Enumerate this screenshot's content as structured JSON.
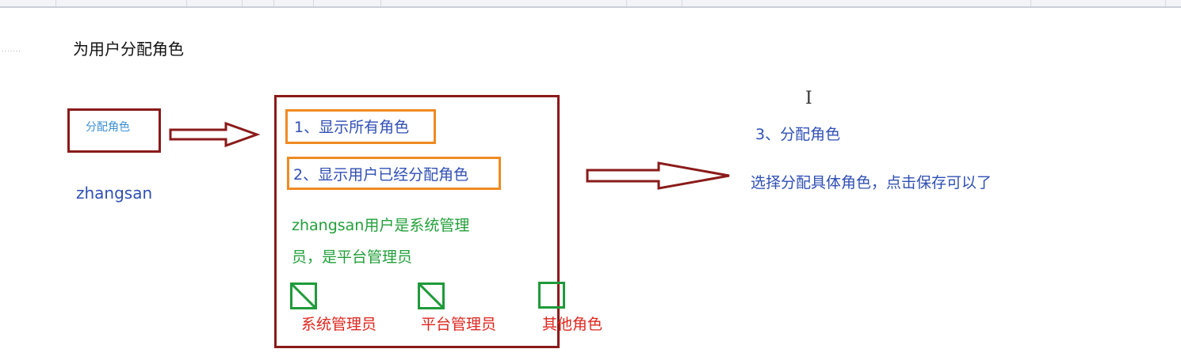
{
  "diagram": {
    "title": "为用户分配角色",
    "assign_button_label": "分配角色",
    "username": "zhangsan",
    "step1": "1、显示所有角色",
    "step2": "2、显示用户已经分配角色",
    "user_roles_line1": "zhangsan用户是系统管理",
    "user_roles_line2": "员，是平台管理员",
    "roles": [
      {
        "label": "系统管理员",
        "checked": true
      },
      {
        "label": "平台管理员",
        "checked": true
      },
      {
        "label": "其他角色",
        "checked": false
      }
    ],
    "step3": "3、分配角色",
    "step3_desc": "选择分配具体角色，点击保存可以了"
  },
  "colors": {
    "frame": "#8b1a1a",
    "highlight": "#f08a22",
    "text_blue": "#2f4fb5",
    "text_green": "#22a03a",
    "text_red": "#e0261e",
    "checkbox": "#1f9a3a"
  }
}
